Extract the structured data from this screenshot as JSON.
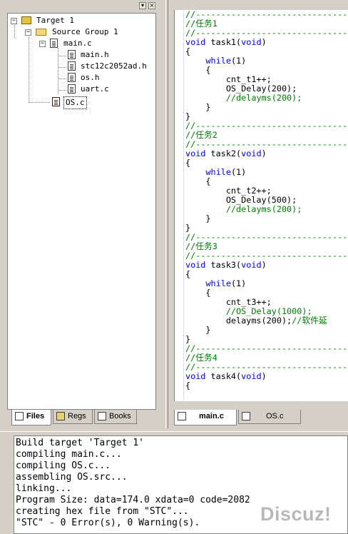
{
  "window_controls": {
    "pin": "▾",
    "close": "×"
  },
  "project": {
    "target": "Target 1",
    "group": "Source Group 1",
    "files": [
      {
        "name": "main.c",
        "expanded": true,
        "children": [
          "main.h",
          "stc12c2052ad.h",
          "os.h",
          "uart.c"
        ]
      },
      {
        "name": "OS.c"
      }
    ],
    "tabs": [
      "Files",
      "Regs",
      "Books"
    ]
  },
  "editor": {
    "tabs": [
      "main.c",
      "OS.c"
    ],
    "lines": [
      "//--------------------------------",
      "//任务1",
      "//--------------------------------",
      "void task1(void)",
      "{",
      "    while(1)",
      "    {",
      "        cnt_t1++;",
      "        OS_Delay(200);",
      "        //delayms(200);",
      "    }",
      "}",
      "//--------------------------------",
      "//任务2",
      "//--------------------------------",
      "void task2(void)",
      "{",
      "    while(1)",
      "    {",
      "        cnt_t2++;",
      "        OS_Delay(500);",
      "        //delayms(200);",
      "    }",
      "}",
      "//--------------------------------",
      "//任务3",
      "//--------------------------------",
      "void task3(void)",
      "{",
      "    while(1)",
      "    {",
      "        cnt_t3++;",
      "        //OS_Delay(1000);",
      "        delayms(200);//软件延",
      "    }",
      "}",
      "//--------------------------------",
      "//任务4",
      "//--------------------------------",
      "void task4(void)",
      "{"
    ]
  },
  "output": {
    "lines": [
      "Build target 'Target 1'",
      "compiling main.c...",
      "compiling OS.c...",
      "assembling OS.src...",
      "linking...",
      "Program Size: data=174.0 xdata=0 code=2082",
      "creating hex file from \"STC\"...",
      "\"STC\" - 0 Error(s), 0 Warning(s)."
    ]
  },
  "watermark": "Discuz!"
}
